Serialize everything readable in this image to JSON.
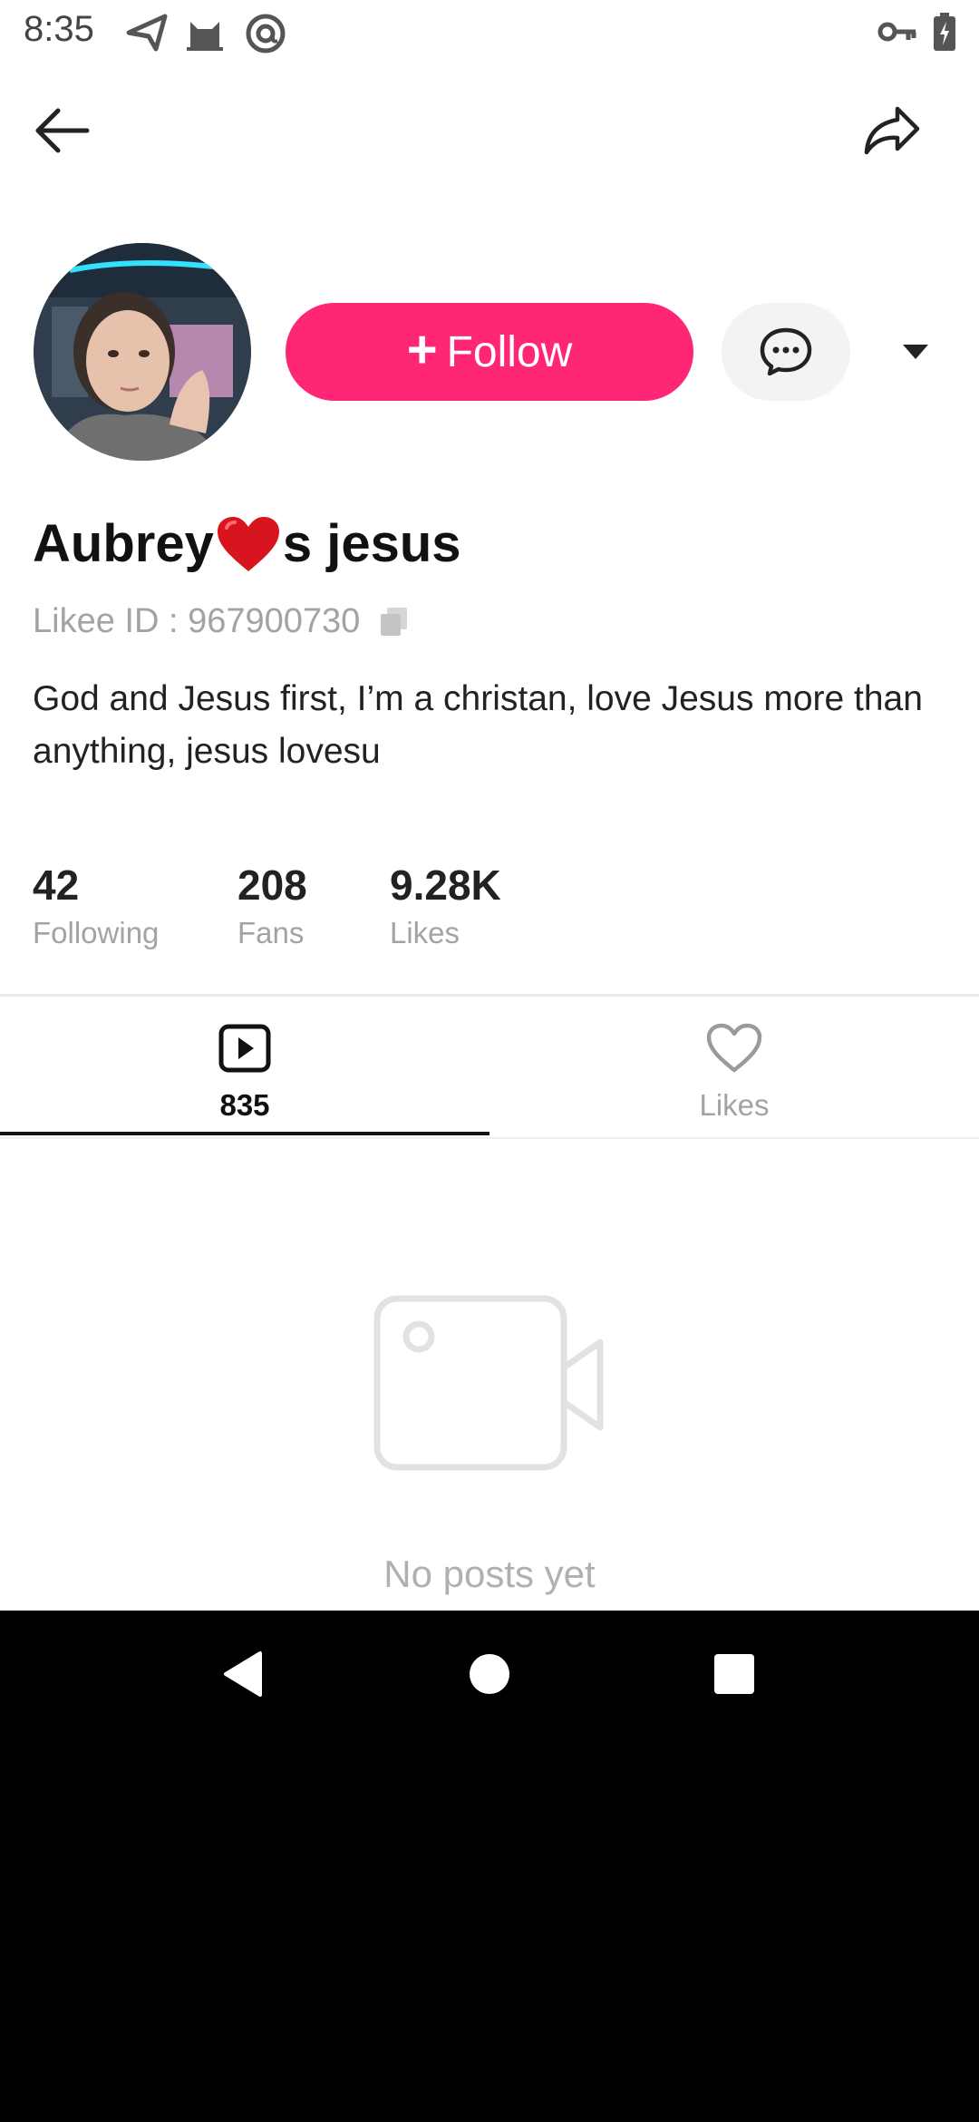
{
  "status_bar": {
    "time": "8:35",
    "left_icons": [
      "send-icon",
      "cat-icon",
      "at-sign-icon"
    ],
    "right_icons": [
      "key-icon",
      "battery-charging-icon"
    ]
  },
  "toolbar": {
    "back_icon": "arrow-left-icon",
    "share_icon": "share-arrow-icon"
  },
  "profile": {
    "follow_label": "Follow",
    "name_part1": "Aubrey",
    "name_emoji": "❤️",
    "name_part2": "s jesus",
    "likee_id": "Likee ID : 967900730",
    "bio": "God and Jesus first, I’m a christan, love Jesus more than anything, jesus lovesu"
  },
  "stats": [
    {
      "value": "42",
      "label": "Following"
    },
    {
      "value": "208",
      "label": "Fans"
    },
    {
      "value": "9.28K",
      "label": "Likes"
    }
  ],
  "tabs": [
    {
      "label": "835",
      "icon": "video-play-icon",
      "active": true
    },
    {
      "label": "Likes",
      "icon": "heart-outline-icon",
      "active": false
    }
  ],
  "empty_state": {
    "icon": "video-camera-icon",
    "text": "No posts yet"
  },
  "colors": {
    "accent": "#ff2775",
    "muted_text": "#a3a3a3",
    "heart": "#d8151f"
  },
  "nav_bar": {
    "icons": [
      "back-triangle-icon",
      "home-circle-icon",
      "recents-square-icon"
    ]
  }
}
